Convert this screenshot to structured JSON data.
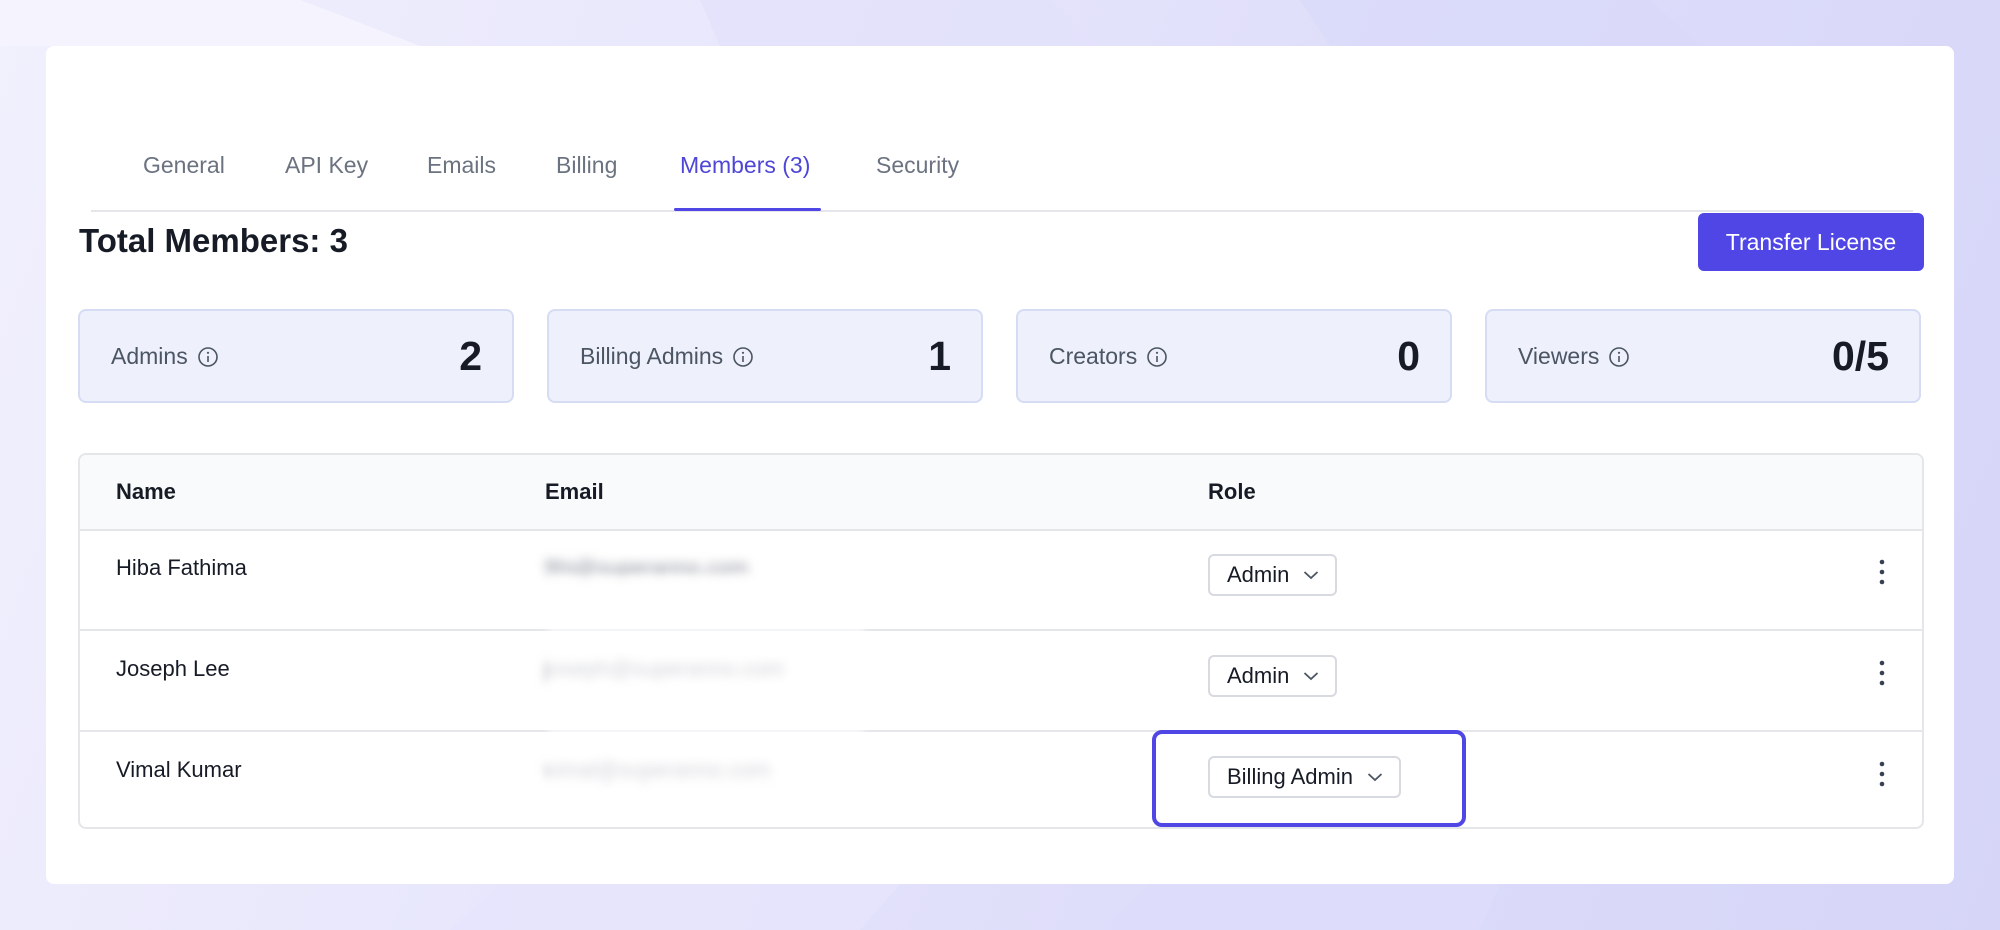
{
  "tabs": [
    {
      "label": "General"
    },
    {
      "label": "API Key"
    },
    {
      "label": "Emails"
    },
    {
      "label": "Billing"
    },
    {
      "label": "Members (3)"
    },
    {
      "label": "Security"
    }
  ],
  "active_tab": "Members (3)",
  "header": {
    "title": "Total Members: 3",
    "transfer_button": "Transfer License"
  },
  "stats": [
    {
      "label": "Admins",
      "value": "2"
    },
    {
      "label": "Billing Admins",
      "value": "1"
    },
    {
      "label": "Creators",
      "value": "0"
    },
    {
      "label": "Viewers",
      "value": "0/5"
    }
  ],
  "table": {
    "columns": [
      "Name",
      "Email",
      "Role"
    ],
    "rows": [
      {
        "name": "Hiba Fathima",
        "email": "fthi@superanno.com",
        "role": "Admin"
      },
      {
        "name": "Joseph Lee",
        "email": "joseph@superanno.com",
        "role": "Admin"
      },
      {
        "name": "Vimal Kumar",
        "email": "vimal@superanno.com",
        "role": "Billing Admin"
      }
    ]
  },
  "colors": {
    "accent": "#4f46e5",
    "card_bg": "#eef1fc",
    "text": "#161b26"
  },
  "icons": {
    "info": "info-circle-icon",
    "dropdown": "chevron-down-icon",
    "menu": "kebab-menu-icon"
  }
}
